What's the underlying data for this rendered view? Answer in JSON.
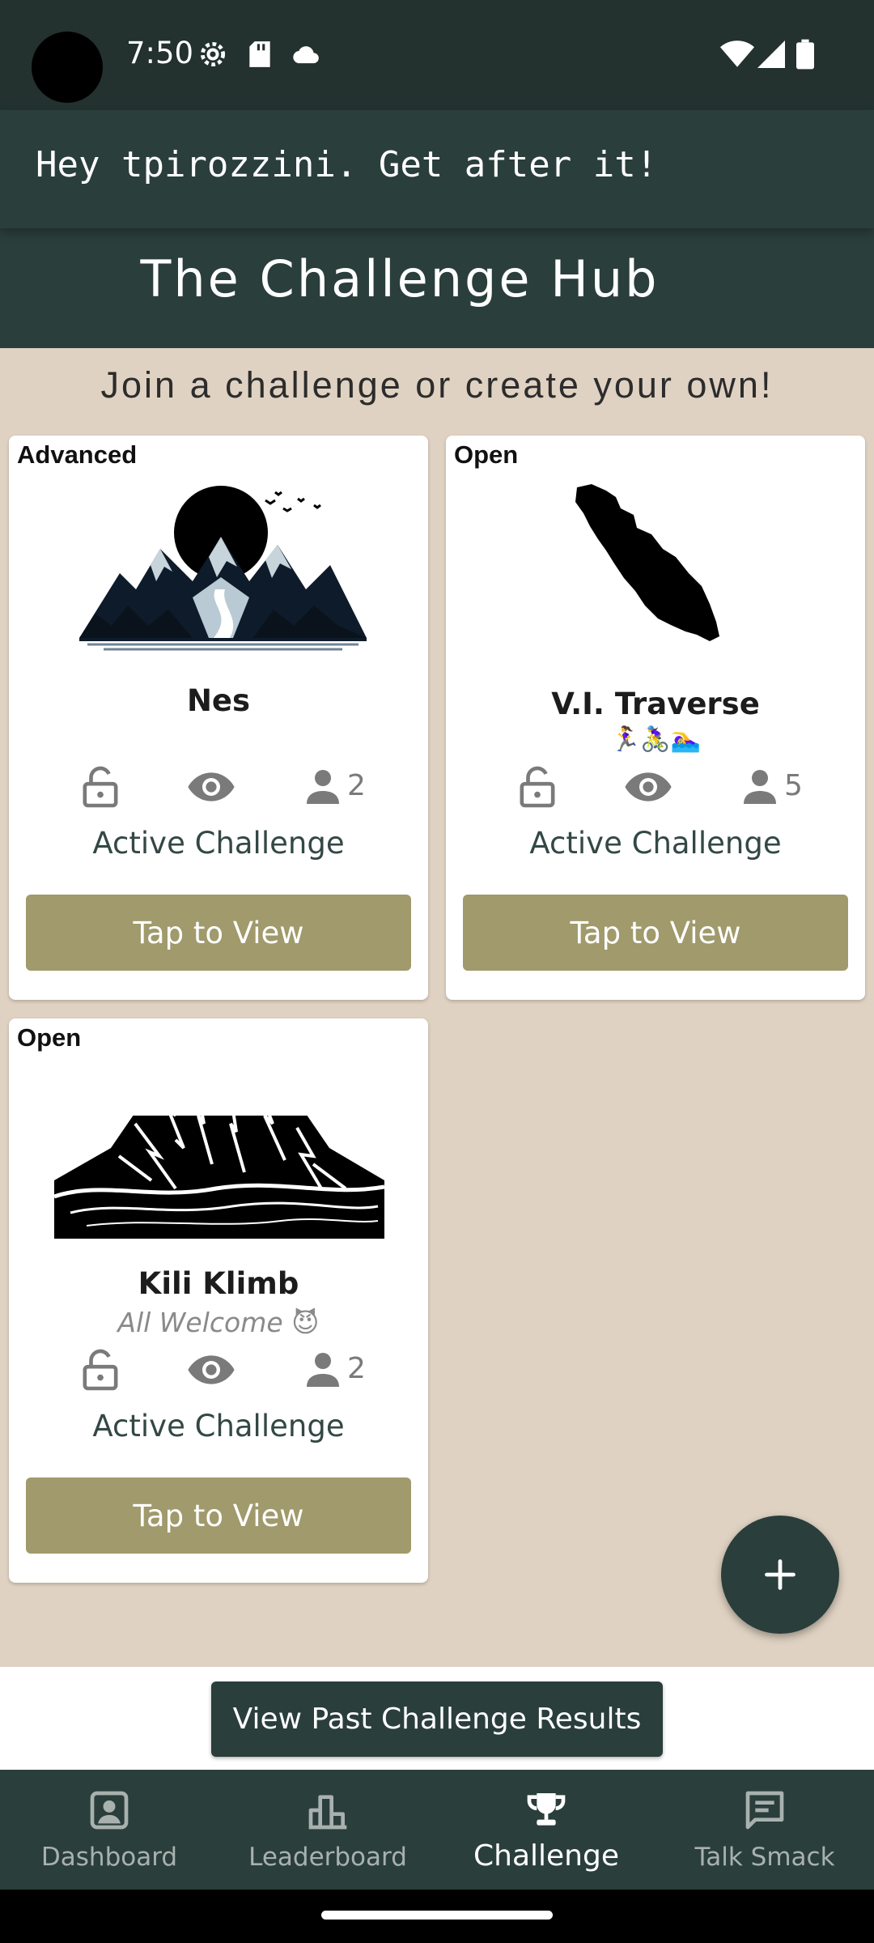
{
  "status_bar": {
    "time": "7:50",
    "left_icons": [
      "settings-gear-icon",
      "sd-card-icon",
      "cloud-icon"
    ],
    "right_icons": [
      "wifi-icon",
      "cell-signal-icon",
      "battery-icon"
    ]
  },
  "header": {
    "greeting": "Hey tpirozzini. Get after it!",
    "title": "The Challenge Hub"
  },
  "subtitle": "Join a challenge or create your own!",
  "cards": [
    {
      "tag": "Advanced",
      "image_icon": "mountain-lake-moon-icon",
      "name": "Nes",
      "sub": "",
      "icons": [
        "lock-open-icon",
        "eye-icon",
        "person-icon"
      ],
      "members": "2",
      "status": "Active Challenge",
      "button_label": "Tap to View"
    },
    {
      "tag": "Open",
      "image_icon": "island-silhouette-icon",
      "name": "V.I. Traverse",
      "sub": "🏃‍♀️🚴‍♀️🏊‍♀️",
      "icons": [
        "lock-open-icon",
        "eye-icon",
        "person-icon"
      ],
      "members": "5",
      "status": "Active Challenge",
      "button_label": "Tap to View"
    },
    {
      "tag": "Open",
      "image_icon": "kilimanjaro-mountain-icon",
      "name": "Kili Klimb",
      "sub": "All Welcome 😈",
      "icons": [
        "lock-open-icon",
        "eye-icon",
        "person-icon"
      ],
      "members": "2",
      "status": "Active Challenge",
      "button_label": "Tap to View"
    }
  ],
  "fab_icon": "plus-icon",
  "past_results_label": "View Past Challenge Results",
  "nav": {
    "items": [
      {
        "label": "Dashboard",
        "icon": "user-badge-icon",
        "active": false
      },
      {
        "label": "Leaderboard",
        "icon": "bar-chart-icon",
        "active": false
      },
      {
        "label": "Challenge",
        "icon": "trophy-icon",
        "active": true
      },
      {
        "label": "Talk Smack",
        "icon": "chat-message-icon",
        "active": false
      }
    ],
    "active_color": "#FFFFFF",
    "inactive_color": "#A8B1AE"
  },
  "colors": {
    "header_bg": "#2A3E3B",
    "page_bg": "#DFD2C2",
    "button_olive": "#A09A6C"
  }
}
